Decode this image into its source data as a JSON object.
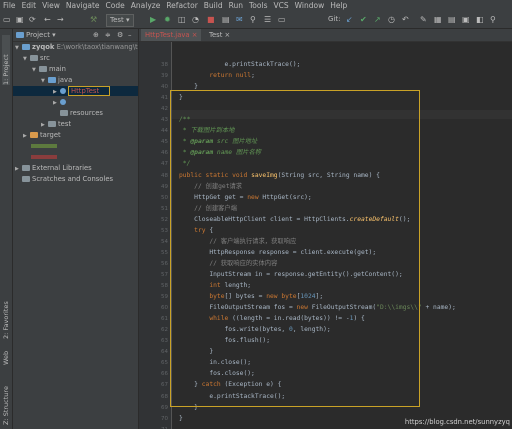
{
  "menu": [
    "File",
    "Edit",
    "View",
    "Navigate",
    "Code",
    "Analyze",
    "Refactor",
    "Build",
    "Run",
    "Tools",
    "VCS",
    "Window",
    "Help"
  ],
  "toolbar": {
    "run_config": "Test",
    "git_label": "Git:"
  },
  "left_strip": {
    "project": "1: Project",
    "favorites": "2: Favorites",
    "web": "Web",
    "structure": "Z: Structure"
  },
  "project_panel": {
    "header": "Project",
    "tree": [
      {
        "label": "zyqok",
        "path": "E:\\work\\taox\\tianwang\\tian"
      },
      {
        "label": "src"
      },
      {
        "label": "main"
      },
      {
        "label": "java"
      },
      {
        "label": "HttpTest"
      },
      {
        "label": ""
      },
      {
        "label": "resources"
      },
      {
        "label": "test"
      },
      {
        "label": "target"
      },
      {
        "label": "External Libraries"
      },
      {
        "label": "Scratches and Consoles"
      }
    ]
  },
  "editor": {
    "tabs": [
      "HttpTest.java",
      "Test"
    ],
    "line_numbers": [
      "38",
      "39",
      "40",
      "41",
      "42",
      "43",
      "44",
      "45",
      "46",
      "47",
      "48",
      "49",
      "50",
      "51",
      "52",
      "53",
      "54",
      "55",
      "56",
      "57",
      "58",
      "59",
      "60",
      "61",
      "62",
      "63",
      "64",
      "65",
      "66",
      "67",
      "68",
      "69",
      "70",
      "71",
      "72"
    ],
    "code": [
      "            e.printStackTrace();",
      "        return null;",
      "    }",
      "}",
      "",
      "/**",
      " * 下载图片到本地",
      " * @param src 图片地址",
      " * @param name 图片名称",
      " */",
      "public static void saveImg(String src, String name) {",
      "    // 创建get请求",
      "    HttpGet get = new HttpGet(src);",
      "    // 创建客户端",
      "    CloseableHttpClient client = HttpClients.createDefault();",
      "    try {",
      "        // 客户端执行请求，获取响应",
      "        HttpResponse response = client.execute(get);",
      "        // 获取响应的实体内容",
      "        InputStream in = response.getEntity().getContent();",
      "        int length;",
      "        byte[] bytes = new byte[1024];",
      "        FileOutputStream fos = new FileOutputStream(\"D:\\\\imgs\\\\\" + name);",
      "        while ((length = in.read(bytes)) != -1) {",
      "            fos.write(bytes, 0, length);",
      "            fos.flush();",
      "        }",
      "        in.close();",
      "        fos.close();",
      "    } catch (Exception e) {",
      "        e.printStackTrace();",
      "    }",
      "}",
      "",
      "}"
    ]
  },
  "watermark": "https://blog.csdn.net/sunnyzyq"
}
